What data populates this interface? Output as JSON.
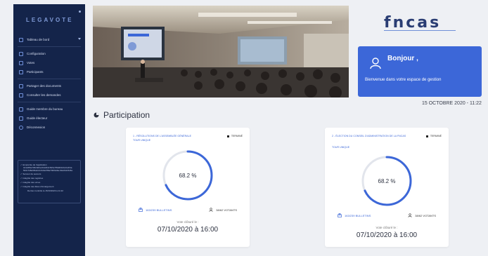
{
  "sidebar": {
    "logo": "LEGAVOTE",
    "items": [
      {
        "label": "Tableau de bord",
        "icon": "home-icon"
      },
      {
        "label": "Configuration",
        "icon": "settings-icon"
      },
      {
        "label": "Votes",
        "icon": "ballot-icon"
      },
      {
        "label": "Participants",
        "icon": "users-icon"
      },
      {
        "label": "Partager des documents",
        "icon": "share-icon"
      },
      {
        "label": "Consulter les demandes",
        "icon": "inbox-icon"
      },
      {
        "label": "Guide membre du bureau",
        "icon": "book-icon"
      },
      {
        "label": "Guide électeur",
        "icon": "book-icon"
      },
      {
        "label": "Déconnexion",
        "icon": "power-icon"
      }
    ],
    "status": {
      "line1": "✓ Empreinte de l'application",
      "line2": "3c4e5f6a7b8c9d0e1f2a3b4c5d6e7f8a9b0c1d2e3f4a",
      "line3": "5b6c7d8e9f0a1b2c3d4e5f6a7b8c9d0e1f2a3b4c5d6e",
      "line4": "✓ Serveur de secours",
      "line5": "✓ Intégrité des registres",
      "line6": "✓ Intégrité des urnes",
      "line7": "✓ Intégrité des listes d'émargement",
      "line8": "Dernier contrôle le 15/10/2020 à 11:22"
    }
  },
  "brand": "fncas",
  "welcome": {
    "greeting": "Bonjour ,",
    "message": "Bienvenue dans votre espace de gestion"
  },
  "datetime": "15 OCTOBRE 2020 - 11:22",
  "participation": {
    "title": "Participation",
    "cards": [
      {
        "title": "1 - RÉSOLUTIONS DE L'ASSEMBLÉE GÉNÉRALE",
        "round": "TOUR UNIQUE",
        "status": "TERMINÉ",
        "percent_label": "68.2 %",
        "percent": 68.2,
        "bulletins": "163/239 BULLETINS",
        "voters": "38/62 VOTANTS",
        "closed_label": "Vote clôturé le :",
        "closed_date": "07/10/2020 à 16:00"
      },
      {
        "title": "2 - ÉLECTION DU CONSEIL D'ADMINISTRATION DE LA FNCAS",
        "round": "TOUR UNIQUE",
        "status": "TERMINÉ",
        "percent_label": "68.2 %",
        "percent": 68.2,
        "bulletins": "163/239 BULLETINS",
        "voters": "38/62 VOTANTS",
        "closed_label": "Vote clôturé le :",
        "closed_date": "07/10/2020 à 16:00"
      }
    ]
  },
  "colors": {
    "sidebar": "#14244a",
    "accent": "#3c67d8",
    "ring_track": "#e2e5ec",
    "ring_dark": "#1f2a44"
  }
}
